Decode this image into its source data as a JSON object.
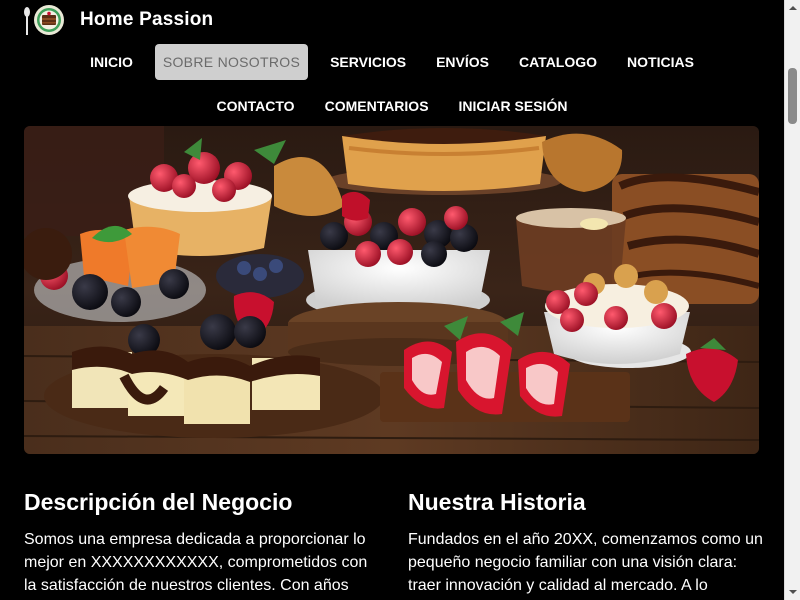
{
  "header": {
    "brand_title": "Home Passion",
    "logo_icon": "chocolate-cake-logo-icon"
  },
  "nav": {
    "row1": [
      {
        "label": "INICIO",
        "active": false
      },
      {
        "label": "SOBRE NOSOTROS",
        "active": true
      },
      {
        "label": "SERVICIOS",
        "active": false
      },
      {
        "label": "ENVÍOS",
        "active": false
      },
      {
        "label": "CATALOGO",
        "active": false
      },
      {
        "label": "NOTICIAS",
        "active": false
      }
    ],
    "row2": [
      {
        "label": "CONTACTO",
        "active": false
      },
      {
        "label": "COMENTARIOS",
        "active": false
      },
      {
        "label": "INICIAR SESIÓN",
        "active": false
      }
    ]
  },
  "hero": {
    "image_icon": "desserts-photo"
  },
  "sections": {
    "left": {
      "title": "Descripción del Negocio",
      "body": "Somos una empresa dedicada a proporcionar lo mejor en XXXXXXXXXXXX, comprometidos con la satisfacción de nuestros clientes. Con años"
    },
    "right": {
      "title": "Nuestra Historia",
      "body": "Fundados en el año 20XX, comenzamos como un pequeño negocio familiar con una visión clara: traer innovación y calidad al mercado. A lo"
    }
  },
  "colors": {
    "background": "#000000",
    "active_nav_bg": "#cfcfcf",
    "active_nav_text": "#6b6b6b"
  }
}
